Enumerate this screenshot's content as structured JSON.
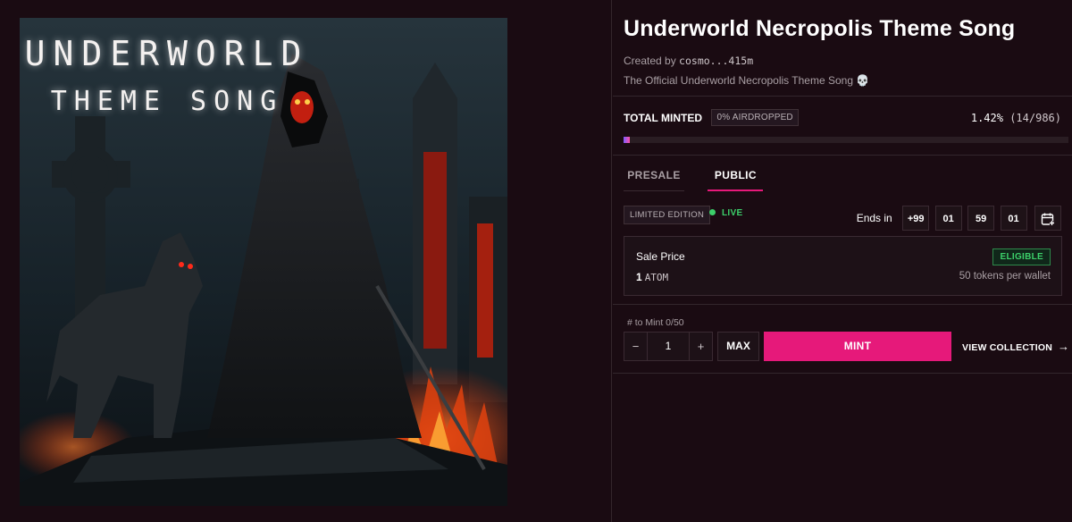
{
  "artwork": {
    "title_line1": "UNDERWORLD",
    "title_line2": "THEME SONG"
  },
  "header": {
    "title": "Underworld Necropolis Theme Song",
    "created_by_label": "Created by",
    "creator_address": "cosmo...415m",
    "description": "The Official Underworld Necropolis Theme Song 💀"
  },
  "minted": {
    "label": "TOTAL MINTED",
    "airdrop_badge": "0% AIRDROPPED",
    "percent": "1.42%",
    "count": "(14/986)",
    "progress_fraction": 0.0142
  },
  "tabs": {
    "presale": "PRESALE",
    "public": "PUBLIC",
    "active": "public"
  },
  "status": {
    "edition_badge": "LIMITED EDITION",
    "live_label": "LIVE",
    "ends_label": "Ends in",
    "countdown": [
      "+99",
      "01",
      "59",
      "01"
    ]
  },
  "sale": {
    "label": "Sale Price",
    "eligibility": "ELIGIBLE",
    "price_amount": "1",
    "price_currency": "ATOM",
    "per_wallet": "50 tokens per wallet"
  },
  "mint": {
    "to_mint_label": "# to Mint 0/50",
    "quantity": "1",
    "minus": "−",
    "plus": "+",
    "max_label": "MAX",
    "mint_label": "MINT",
    "view_collection_label": "VIEW COLLECTION",
    "arrow": "→"
  },
  "icons": {
    "calendar": "calendar-add-icon",
    "live_dot": "live-dot-icon",
    "arrow": "arrow-right-icon"
  },
  "colors": {
    "background": "#1a0b12",
    "accent": "#e6197a",
    "live_green": "#3ccf6a"
  }
}
